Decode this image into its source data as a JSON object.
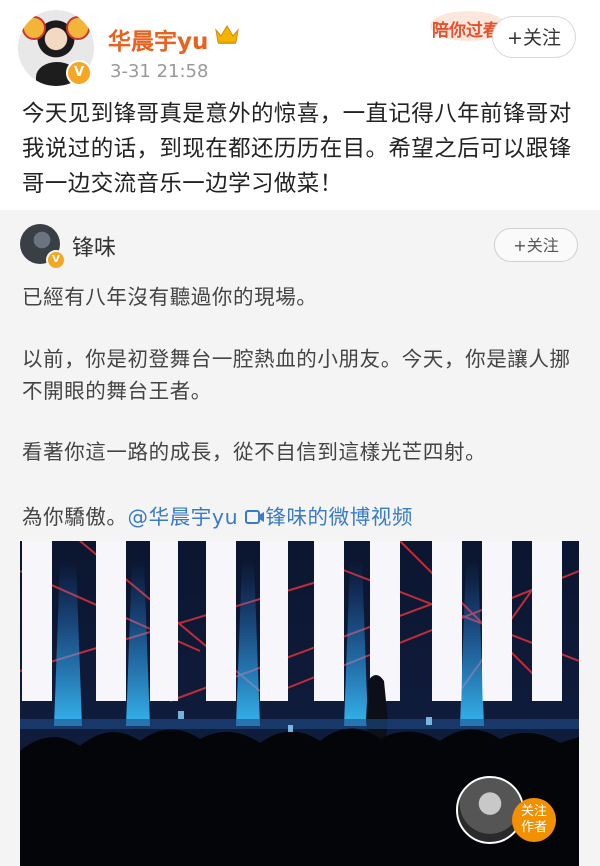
{
  "post": {
    "username": "华晨宇yu",
    "timestamp": "3-31 21:58",
    "follow_label": "+关注",
    "promo_text": "陪你过春",
    "text": "今天见到锋哥真是意外的惊喜，一直记得八年前锋哥对我说过的话，到现在都还历历在目。希望之后可以跟锋哥一边交流音乐一边学习做菜！"
  },
  "repost": {
    "username": "锋味",
    "follow_label": "+关注",
    "para1": "已經有八年沒有聽過你的現場。",
    "para2": "以前，你是初登舞台一腔熱血的小朋友。今天，你是讓人挪不開眼的舞台王者。",
    "para3": "看著你這一路的成長，從不自信到這樣光芒四射。",
    "para4_prefix": "為你驕傲。",
    "mention": "@华晨宇yu",
    "video_link": "锋味的微博视频",
    "float_label_line1": "关注",
    "float_label_line2": "作者"
  },
  "colors": {
    "username": "#e8611f",
    "link": "#3a7bc8",
    "verified": "#f5a623",
    "follow_author_badge": "#f29100"
  },
  "icons": [
    "crown-icon",
    "verified-icon",
    "video-icon"
  ]
}
